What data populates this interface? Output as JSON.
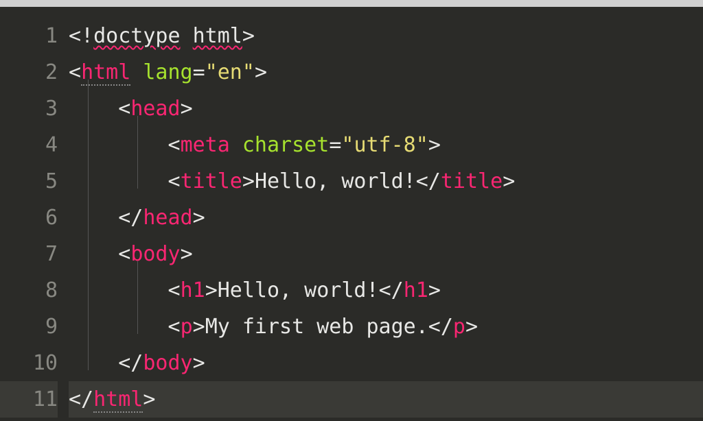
{
  "editor": {
    "line_numbers": [
      "1",
      "2",
      "3",
      "4",
      "5",
      "6",
      "7",
      "8",
      "9",
      "10",
      "11"
    ],
    "active_line": 11,
    "syntax": {
      "doctype_decl_open": "<!",
      "doctype_word": "doctype",
      "doctype_html": "html",
      "gt": ">",
      "lt": "<",
      "lt_slash": "</",
      "tag_html": "html",
      "tag_head": "head",
      "tag_meta": "meta",
      "tag_title": "title",
      "tag_body": "body",
      "tag_h1": "h1",
      "tag_p": "p",
      "attr_lang": "lang",
      "attr_charset": "charset",
      "eq": "=",
      "q": "\"",
      "val_en": "en",
      "val_utf8": "utf-8",
      "text_title": "Hello, world!",
      "text_h1": "Hello, world!",
      "text_p": "My first web page.",
      "sp": " "
    },
    "indent_guides": [
      {
        "col": 1,
        "from": 3,
        "to": 10
      },
      {
        "col": 2,
        "from": 4,
        "to": 5
      },
      {
        "col": 2,
        "from": 8,
        "to": 9
      }
    ]
  }
}
